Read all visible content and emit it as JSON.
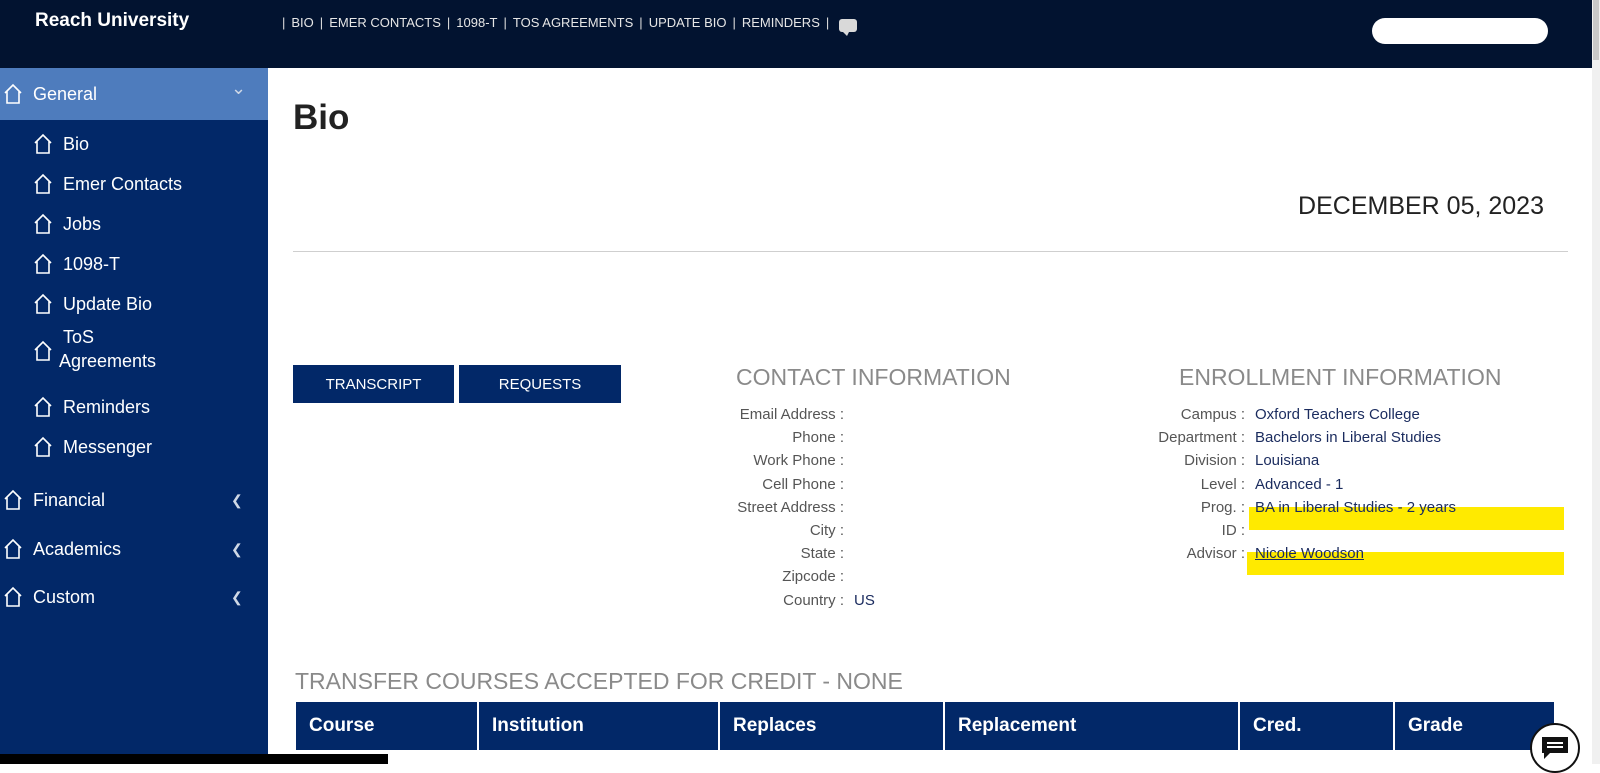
{
  "brand": "Reach University",
  "topnav": {
    "items": [
      "BIO",
      "EMER CONTACTS",
      "1098-T",
      "TOS AGREEMENTS",
      "UPDATE BIO",
      "REMINDERS"
    ],
    "chat_icon": "chat-bubble-icon"
  },
  "sidebar": {
    "general": {
      "label": "General",
      "chevron": "⌄"
    },
    "general_items": [
      {
        "label": "Bio"
      },
      {
        "label": "Emer Contacts"
      },
      {
        "label": "Jobs"
      },
      {
        "label": "1098-T"
      },
      {
        "label": "Update Bio"
      },
      {
        "label": "ToS",
        "label2": "Agreements"
      },
      {
        "label": "Reminders"
      },
      {
        "label": "Messenger"
      }
    ],
    "financial": {
      "label": "Financial",
      "chevron": "❮"
    },
    "academics": {
      "label": "Academics",
      "chevron": "❮"
    },
    "custom": {
      "label": "Custom",
      "chevron": "❮"
    },
    "icon": "home-icon"
  },
  "main": {
    "title": "Bio",
    "date": "DECEMBER 05, 2023",
    "buttons": {
      "transcript": "TRANSCRIPT",
      "requests": "REQUESTS"
    },
    "contact": {
      "heading": "CONTACT INFORMATION",
      "rows": [
        {
          "label": "Email Address :",
          "value": ""
        },
        {
          "label": "Phone :",
          "value": ""
        },
        {
          "label": "Work Phone :",
          "value": ""
        },
        {
          "label": "Cell Phone :",
          "value": ""
        },
        {
          "label": "Street Address :",
          "value": ""
        },
        {
          "label": "City :",
          "value": ""
        },
        {
          "label": "State :",
          "value": ""
        },
        {
          "label": "Zipcode :",
          "value": ""
        },
        {
          "label": "Country :",
          "value": "US"
        }
      ]
    },
    "enrollment": {
      "heading": "ENROLLMENT INFORMATION",
      "rows": [
        {
          "label": "Campus :",
          "value": "Oxford Teachers College"
        },
        {
          "label": "Department :",
          "value": "Bachelors in Liberal Studies"
        },
        {
          "label": "Division :",
          "value": "Louisiana"
        },
        {
          "label": "Level :",
          "value": "Advanced - 1"
        },
        {
          "label": "Prog. :",
          "value": "BA in Liberal Studies - 2 years"
        },
        {
          "label": "ID :",
          "value": ""
        },
        {
          "label": "Advisor :",
          "value": "Nicole Woodson"
        }
      ],
      "highlight_color": "#ffea00"
    },
    "transfer": {
      "heading": "TRANSFER COURSES ACCEPTED FOR CREDIT - NONE",
      "columns": [
        "Course",
        "Institution",
        "Replaces",
        "Replacement",
        "Cred.",
        "Grade"
      ]
    }
  },
  "colors": {
    "topbar": "#021330",
    "sidebar": "#022868",
    "sidebar_active": "#4e7cbd",
    "accent": "#022868"
  }
}
